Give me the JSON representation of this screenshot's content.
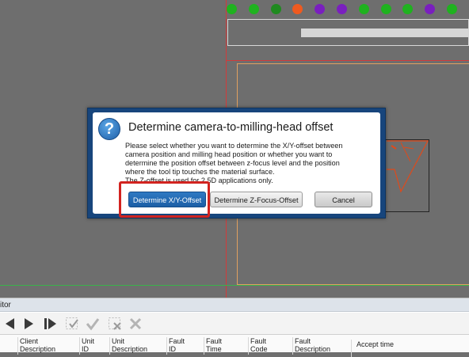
{
  "status_dots": [
    {
      "color": "#1fb21f"
    },
    {
      "color": "#1fb21f"
    },
    {
      "color": "#1f8a1f"
    },
    {
      "color": "#ef5a1f"
    },
    {
      "color": "#7a1fbf"
    },
    {
      "color": "#7a1fbf"
    },
    {
      "color": "#1fb21f"
    },
    {
      "color": "#1fb21f"
    },
    {
      "color": "#1fb21f"
    },
    {
      "color": "#7a1fbf"
    },
    {
      "color": "#1fb21f"
    }
  ],
  "dialog": {
    "title": "Determine camera-to-milling-head offset",
    "icon": "question-icon",
    "body_lines": [
      "Please select whether you want to determine the  X/Y-offset between",
      "camera position and milling head position or whether you want to",
      "determine the position offset between z-focus level and the position",
      "where the tool tip touches the material surface.",
      "The Z-offset is used for 2.5D applications only."
    ],
    "buttons": {
      "xy": "Determine X/Y-Offset",
      "z": "Determine Z-Focus-Offset",
      "cancel": "Cancel"
    },
    "colors": {
      "frame": "#17457c",
      "primary": "#1c5fa6",
      "highlight": "#d2231f"
    }
  },
  "monitor": {
    "title": "itor",
    "toolbar": [
      "first-icon",
      "next-icon",
      "last-icon",
      "accept-selected-icon",
      "check-icon",
      "remove-selected-icon",
      "delete-icon"
    ],
    "columns": [
      {
        "line1": "Client",
        "line2": "Description"
      },
      {
        "line1": "Unit",
        "line2": "ID"
      },
      {
        "line1": "Unit",
        "line2": "Description"
      },
      {
        "line1": "Fault",
        "line2": "ID"
      },
      {
        "line1": "Fault",
        "line2": "Time"
      },
      {
        "line1": "Fault",
        "line2": "Code"
      },
      {
        "line1": "Fault",
        "line2": "Description"
      },
      {
        "line1": "Accept time",
        "line2": ""
      }
    ]
  }
}
